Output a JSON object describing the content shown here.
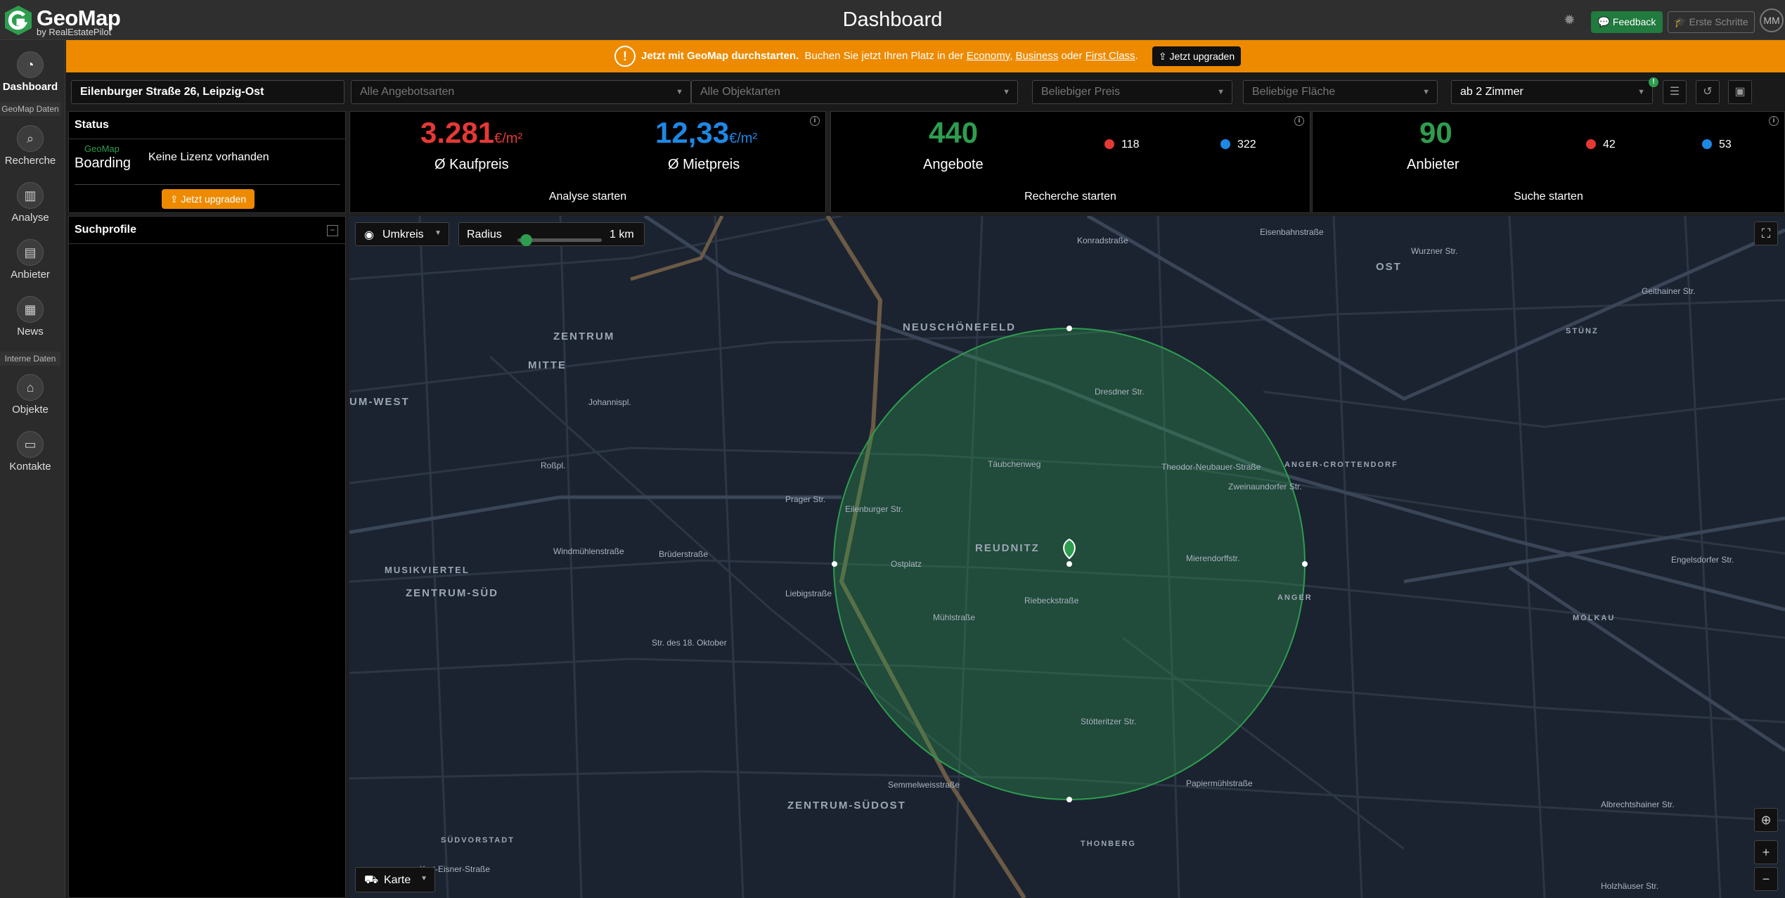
{
  "app": {
    "name": "GeoMap",
    "sub": "by RealEstatePilot",
    "page_title": "Dashboard"
  },
  "topbar": {
    "feedback": "Feedback",
    "first_steps": "Erste Schritte",
    "avatar": "MM"
  },
  "banner": {
    "lead": "Jetzt mit GeoMap durchstarten.",
    "text": "Buchen Sie jetzt Ihren Platz in der",
    "economy": "Economy,",
    "business": "Business",
    "oder": "oder",
    "first": "First Class",
    "dot": ".",
    "button": "Jetzt upgraden"
  },
  "sidebar": {
    "dashboard": "Dashboard",
    "section_geomap": "GeoMap Daten",
    "recherche": "Recherche",
    "analyse": "Analyse",
    "anbieter": "Anbieter",
    "news": "News",
    "section_intern": "Interne Daten",
    "objekte": "Objekte",
    "kontakte": "Kontakte"
  },
  "filters": {
    "address": "Eilenburger Straße 26, Leipzig-Ost",
    "offer_types": "Alle Angebotsarten",
    "object_types": "Alle Objektarten",
    "price": "Beliebiger Preis",
    "area": "Beliebige Fläche",
    "rooms": "ab 2 Zimmer",
    "rooms_badge": "!"
  },
  "status": {
    "title": "Status",
    "geomap": "GeoMap",
    "plan": "Boarding",
    "license": "Keine Lizenz vorhanden",
    "button": "Jetzt upgraden"
  },
  "profiles": {
    "title": "Suchprofile",
    "collapse": "−"
  },
  "kpi": {
    "buy_value": "3.281",
    "buy_unit": "€/m²",
    "buy_label": "Ø Kaufpreis",
    "rent_value": "12,33",
    "rent_unit": "€/m²",
    "rent_label": "Ø Mietpreis",
    "analysis_link": "Analyse starten",
    "offers_value": "440",
    "offers_label": "Angebote",
    "offers_red": "118",
    "offers_blue": "322",
    "offers_link": "Recherche starten",
    "providers_value": "90",
    "providers_label": "Anbieter",
    "providers_red": "42",
    "providers_blue": "53",
    "providers_link": "Suche starten",
    "info": "i"
  },
  "colors": {
    "red": "#e53935",
    "blue": "#1e88e5",
    "green": "#2e9d4f",
    "orange": "#ed8a00"
  },
  "map": {
    "mode": "Umkreis",
    "radius_label": "Radius",
    "radius_value": "1 km",
    "radius_fraction": 0.05,
    "layer": "Karte",
    "districts": [
      "ZENTRUM",
      "MITTE",
      "NEUSCHÖNEFELD",
      "OST",
      "UM-WEST",
      "MUSIKVIERTEL",
      "ZENTRUM-SÜD",
      "REUDNITZ",
      "ANGER-CROTTENDORF",
      "ZENTRUM-SÜDOST",
      "SÜDVORSTADT",
      "THONBERG",
      "STÜNZ",
      "MÖLKAU",
      "ANGER"
    ],
    "streets": [
      "Dresdner Str.",
      "Täubchenweg",
      "Eisenbahnstraße",
      "Wurzner Str.",
      "Konradstraße",
      "Zweinaundorfer Str.",
      "Engelsdorfer Str.",
      "Stötteritzer Str.",
      "Riebeckstraße",
      "Semmelweisstraße",
      "Papiermühlstraße",
      "Albrechtshainer Str.",
      "Johannispl.",
      "Roßpl.",
      "Prager Str.",
      "Ostplatz",
      "Mühlstraße",
      "Kurt-Eisner-Straße",
      "Str. des 18. Oktober",
      "Geithainer Str.",
      "Holzhäuser Str.",
      "Eilenburger Str.",
      "Liebigstraße",
      "Brüderstraße",
      "Windmühlenstraße",
      "Mierendorffstr.",
      "Theodor-Neubauer-Straße"
    ]
  }
}
